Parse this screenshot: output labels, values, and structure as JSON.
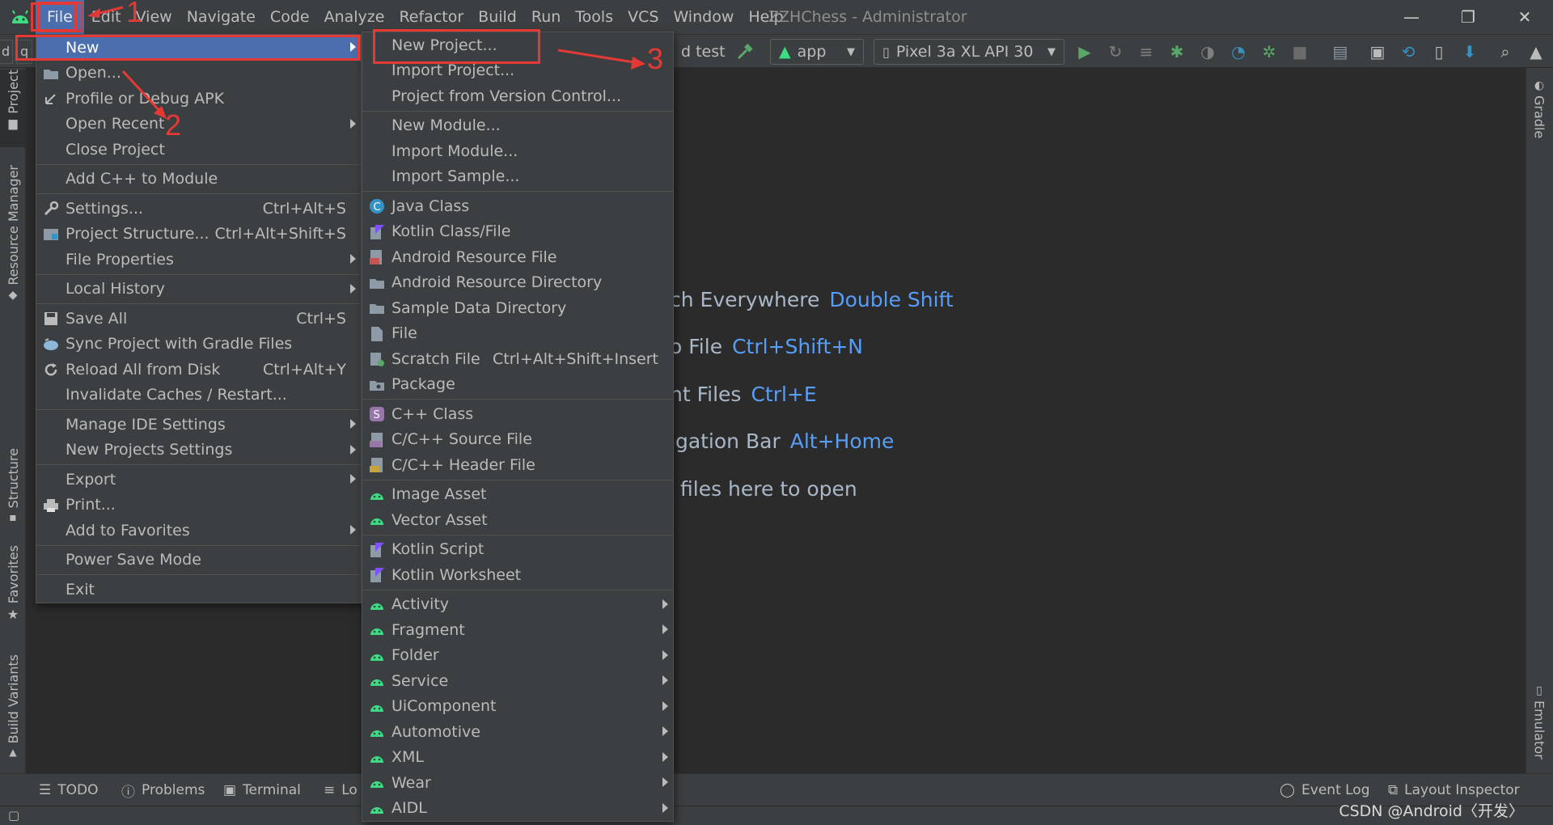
{
  "window": {
    "title": "ZZHChess - Administrator",
    "controls": [
      "—",
      "❐",
      "✕"
    ]
  },
  "menubar": [
    "File",
    "Edit",
    "View",
    "Navigate",
    "Code",
    "Analyze",
    "Refactor",
    "Build",
    "Run",
    "Tools",
    "VCS",
    "Window",
    "Help"
  ],
  "toolbar": {
    "partial_label": "d test",
    "config": "app",
    "device": "Pixel 3a XL API 30",
    "crumb_letter": "q"
  },
  "left_tabs": [
    "Project",
    "Resource Manager",
    "Structure",
    "Favorites",
    "Build Variants"
  ],
  "right_tabs": [
    "Gradle",
    "Emulator"
  ],
  "editor_hints": [
    {
      "text": "ch Everywhere",
      "key": "Double Shift"
    },
    {
      "text": "o File",
      "key": "Ctrl+Shift+N"
    },
    {
      "text": "nt Files",
      "key": "Ctrl+E"
    },
    {
      "text": "igation Bar",
      "key": "Alt+Home"
    },
    {
      "text": "files here to open",
      "key": ""
    }
  ],
  "bottom_tabs": [
    "TODO",
    "Problems",
    "Terminal",
    "Lo",
    "Event Log",
    "Layout Inspector"
  ],
  "watermark": "CSDN @Android〈开发〉",
  "file_menu": [
    {
      "label": "New",
      "shortcut": "",
      "submenu": true,
      "selected": true,
      "icon": ""
    },
    {
      "label": "Open...",
      "shortcut": "",
      "icon": "folder-icon"
    },
    {
      "label": "Profile or Debug APK",
      "shortcut": "",
      "icon": "profile-icon"
    },
    {
      "label": "Open Recent",
      "shortcut": "",
      "submenu": true
    },
    {
      "label": "Close Project",
      "shortcut": ""
    },
    {
      "sep": true
    },
    {
      "label": "Add C++ to Module",
      "shortcut": ""
    },
    {
      "sep": true
    },
    {
      "label": "Settings...",
      "shortcut": "Ctrl+Alt+S",
      "icon": "wrench-icon"
    },
    {
      "label": "Project Structure...",
      "shortcut": "Ctrl+Alt+Shift+S",
      "icon": "project-structure-icon"
    },
    {
      "label": "File Properties",
      "shortcut": "",
      "submenu": true
    },
    {
      "sep": true
    },
    {
      "label": "Local History",
      "shortcut": "",
      "submenu": true
    },
    {
      "sep": true
    },
    {
      "label": "Save All",
      "shortcut": "Ctrl+S",
      "icon": "save-icon"
    },
    {
      "label": "Sync Project with Gradle Files",
      "shortcut": "",
      "icon": "gradle-sync-icon"
    },
    {
      "label": "Reload All from Disk",
      "shortcut": "Ctrl+Alt+Y",
      "icon": "reload-icon"
    },
    {
      "label": "Invalidate Caches / Restart...",
      "shortcut": ""
    },
    {
      "sep": true
    },
    {
      "label": "Manage IDE Settings",
      "shortcut": "",
      "submenu": true
    },
    {
      "label": "New Projects Settings",
      "shortcut": "",
      "submenu": true
    },
    {
      "sep": true
    },
    {
      "label": "Export",
      "shortcut": "",
      "submenu": true
    },
    {
      "label": "Print...",
      "shortcut": "",
      "icon": "print-icon"
    },
    {
      "label": "Add to Favorites",
      "shortcut": "",
      "submenu": true
    },
    {
      "sep": true
    },
    {
      "label": "Power Save Mode",
      "shortcut": ""
    },
    {
      "sep": true
    },
    {
      "label": "Exit",
      "shortcut": ""
    }
  ],
  "new_menu": [
    {
      "label": "New Project...",
      "icon": ""
    },
    {
      "label": "Import Project...",
      "icon": ""
    },
    {
      "label": "Project from Version Control...",
      "icon": ""
    },
    {
      "sep": true
    },
    {
      "label": "New Module...",
      "icon": ""
    },
    {
      "label": "Import Module...",
      "icon": ""
    },
    {
      "label": "Import Sample...",
      "icon": ""
    },
    {
      "sep": true
    },
    {
      "label": "Java Class",
      "icon": "java-class-icon"
    },
    {
      "label": "Kotlin Class/File",
      "icon": "kotlin-icon"
    },
    {
      "label": "Android Resource File",
      "icon": "resource-file-icon"
    },
    {
      "label": "Android Resource Directory",
      "icon": "folder-icon"
    },
    {
      "label": "Sample Data Directory",
      "icon": "folder-icon"
    },
    {
      "label": "File",
      "icon": "file-icon"
    },
    {
      "label": "Scratch File",
      "shortcut": "Ctrl+Alt+Shift+Insert",
      "icon": "scratch-icon"
    },
    {
      "label": "Package",
      "icon": "package-icon"
    },
    {
      "sep": true
    },
    {
      "label": "C++ Class",
      "icon": "cpp-class-icon"
    },
    {
      "label": "C/C++ Source File",
      "icon": "cpp-source-icon"
    },
    {
      "label": "C/C++ Header File",
      "icon": "cpp-header-icon"
    },
    {
      "sep": true
    },
    {
      "label": "Image Asset",
      "icon": "android-icon"
    },
    {
      "label": "Vector Asset",
      "icon": "android-icon"
    },
    {
      "sep": true
    },
    {
      "label": "Kotlin Script",
      "icon": "kotlin-icon"
    },
    {
      "label": "Kotlin Worksheet",
      "icon": "kotlin-icon"
    },
    {
      "sep": true
    },
    {
      "label": "Activity",
      "icon": "android-icon",
      "submenu": true
    },
    {
      "label": "Fragment",
      "icon": "android-icon",
      "submenu": true
    },
    {
      "label": "Folder",
      "icon": "android-icon",
      "submenu": true
    },
    {
      "label": "Service",
      "icon": "android-icon",
      "submenu": true
    },
    {
      "label": "UiComponent",
      "icon": "android-icon",
      "submenu": true
    },
    {
      "label": "Automotive",
      "icon": "android-icon",
      "submenu": true
    },
    {
      "label": "XML",
      "icon": "android-icon",
      "submenu": true
    },
    {
      "label": "Wear",
      "icon": "android-icon",
      "submenu": true
    },
    {
      "label": "AIDL",
      "icon": "android-icon",
      "submenu": true
    }
  ],
  "annotations": [
    "1",
    "2",
    "3"
  ],
  "colors": {
    "accent": "#4b6eaf",
    "annotation": "#e53935",
    "android_green": "#3ddc84",
    "hint_key": "#589df6"
  }
}
